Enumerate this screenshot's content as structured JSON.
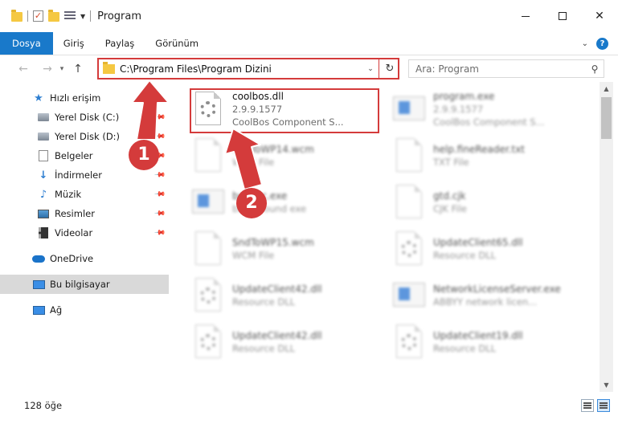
{
  "window": {
    "title": "Program",
    "controls": {
      "minimize": "—",
      "maximize": "☐",
      "close": "✕"
    }
  },
  "ribbon": {
    "tabs": [
      {
        "label": "Dosya",
        "active": true
      },
      {
        "label": "Giriş"
      },
      {
        "label": "Paylaş"
      },
      {
        "label": "Görünüm"
      }
    ],
    "help": "?"
  },
  "address": {
    "path": "C:\\Program Files\\Program Dizini"
  },
  "search": {
    "placeholder": "Ara: Program"
  },
  "sidebar": {
    "items": [
      {
        "label": "Hızlı erişim",
        "icon": "star-icon"
      },
      {
        "label": "Yerel Disk (C:)",
        "icon": "disk-icon",
        "pinned": true
      },
      {
        "label": "Yerel Disk (D:)",
        "icon": "disk-icon",
        "pinned": true
      },
      {
        "label": "Belgeler",
        "icon": "documents-icon",
        "pinned": true
      },
      {
        "label": "İndirmeler",
        "icon": "download-icon",
        "pinned": true
      },
      {
        "label": "Müzik",
        "icon": "music-icon",
        "pinned": true
      },
      {
        "label": "Resimler",
        "icon": "pictures-icon",
        "pinned": true
      },
      {
        "label": "Videolar",
        "icon": "video-icon",
        "pinned": true
      },
      {
        "label": "OneDrive",
        "icon": "cloud-icon"
      },
      {
        "label": "Bu bilgisayar",
        "icon": "computer-icon",
        "selected": true
      },
      {
        "label": "Ağ",
        "icon": "network-icon"
      }
    ]
  },
  "files": [
    {
      "name": "coolbos.dll",
      "line2": "2.9.9.1577",
      "line3": "CoolBos Component S...",
      "kind": "dll",
      "highlighted": true
    },
    {
      "name": "program.exe",
      "line2": "2.9.9.1577",
      "line3": "CoolBos Component S...",
      "kind": "exe"
    },
    {
      "name": "SndToWP14.wcm",
      "line2": "WCM File",
      "kind": "file"
    },
    {
      "name": "help.fineReader.txt",
      "line2": "TXT File",
      "kind": "file"
    },
    {
      "name": "bgexec.exe",
      "line2": "background exe",
      "kind": "exe"
    },
    {
      "name": "gtd.cjk",
      "line2": "CJK File",
      "kind": "file"
    },
    {
      "name": "SndToWP15.wcm",
      "line2": "WCM File",
      "kind": "file"
    },
    {
      "name": "UpdateClient65.dll",
      "line2": "Resource DLL",
      "kind": "dll"
    },
    {
      "name": "UpdateClient42.dll",
      "line2": "Resource DLL",
      "kind": "dll"
    },
    {
      "name": "NetworkLicenseServer.exe",
      "line2": "ABBYY network licen...",
      "kind": "exe"
    },
    {
      "name": "UpdateClient42.dll",
      "line2": "Resource DLL",
      "kind": "dll"
    },
    {
      "name": "UpdateClient19.dll",
      "line2": "Resource DLL",
      "kind": "dll"
    }
  ],
  "status": {
    "count": "128 öğe"
  },
  "annotations": {
    "badge1": "1",
    "badge2": "2",
    "color": "#d43b3b"
  }
}
